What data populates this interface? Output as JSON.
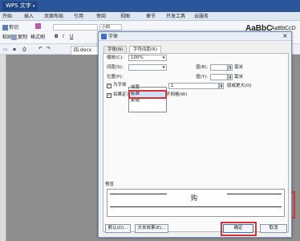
{
  "titlebar": {
    "app_name": "WPS 文字"
  },
  "ribbon_tabs": [
    "开始",
    "插入",
    "页面布局",
    "引用",
    "审阅",
    "视图",
    "章节",
    "开发工具",
    "云服务"
  ],
  "ribbon": {
    "cut": "剪切",
    "copy": "复制",
    "format_painter": "格式刷",
    "paste": "粘贴",
    "font_size": "小四",
    "style1": "AaBbC",
    "style2": "AaBbCcD"
  },
  "document_tab": {
    "label": "四.docx"
  },
  "dialog": {
    "title": "字体",
    "tabs": [
      "字体(N)",
      "字符间距(R)"
    ],
    "scale_label": "缩放(C):",
    "scale_value": "100%",
    "spacing_label": "间距(S):",
    "spacing_value": "",
    "spacing_amount_label": "值(B):",
    "spacing_unit": "毫米",
    "position_label": "位置(P):",
    "position_amount_label": "值(Y):",
    "position_unit": "毫米",
    "kerning_label": "为字体",
    "kerning_value": "1",
    "kerning_suffix": "磅或更大(O)",
    "grid_label": "如果定义了文档网格，则对齐网格(W)",
    "dropdown_options": [
      "加宽",
      "标准",
      "紧缩"
    ],
    "preview_label": "预览",
    "preview_text": "购",
    "default_button": "默认(D)...",
    "text_effect_button": "文本效果(E)...",
    "ok_button": "确定",
    "cancel_button": "取消"
  }
}
